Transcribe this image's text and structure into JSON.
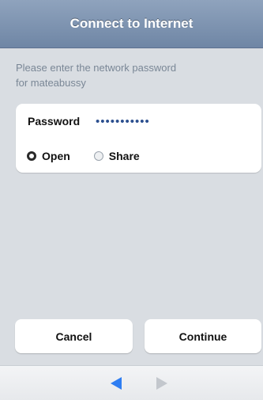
{
  "header": {
    "title": "Connect to Internet"
  },
  "prompt": {
    "line1": "Please enter the network password",
    "line2": "for mateabussy"
  },
  "password": {
    "label": "Password",
    "value": "•••••••••••"
  },
  "options": [
    {
      "label": "Open",
      "selected": true
    },
    {
      "label": "Share",
      "selected": false
    }
  ],
  "buttons": {
    "cancel": "Cancel",
    "continue": "Continue"
  },
  "navigation": {
    "back_icon": "back-arrow-icon",
    "forward_icon": "forward-arrow-icon",
    "accent": "#2e7df2"
  }
}
